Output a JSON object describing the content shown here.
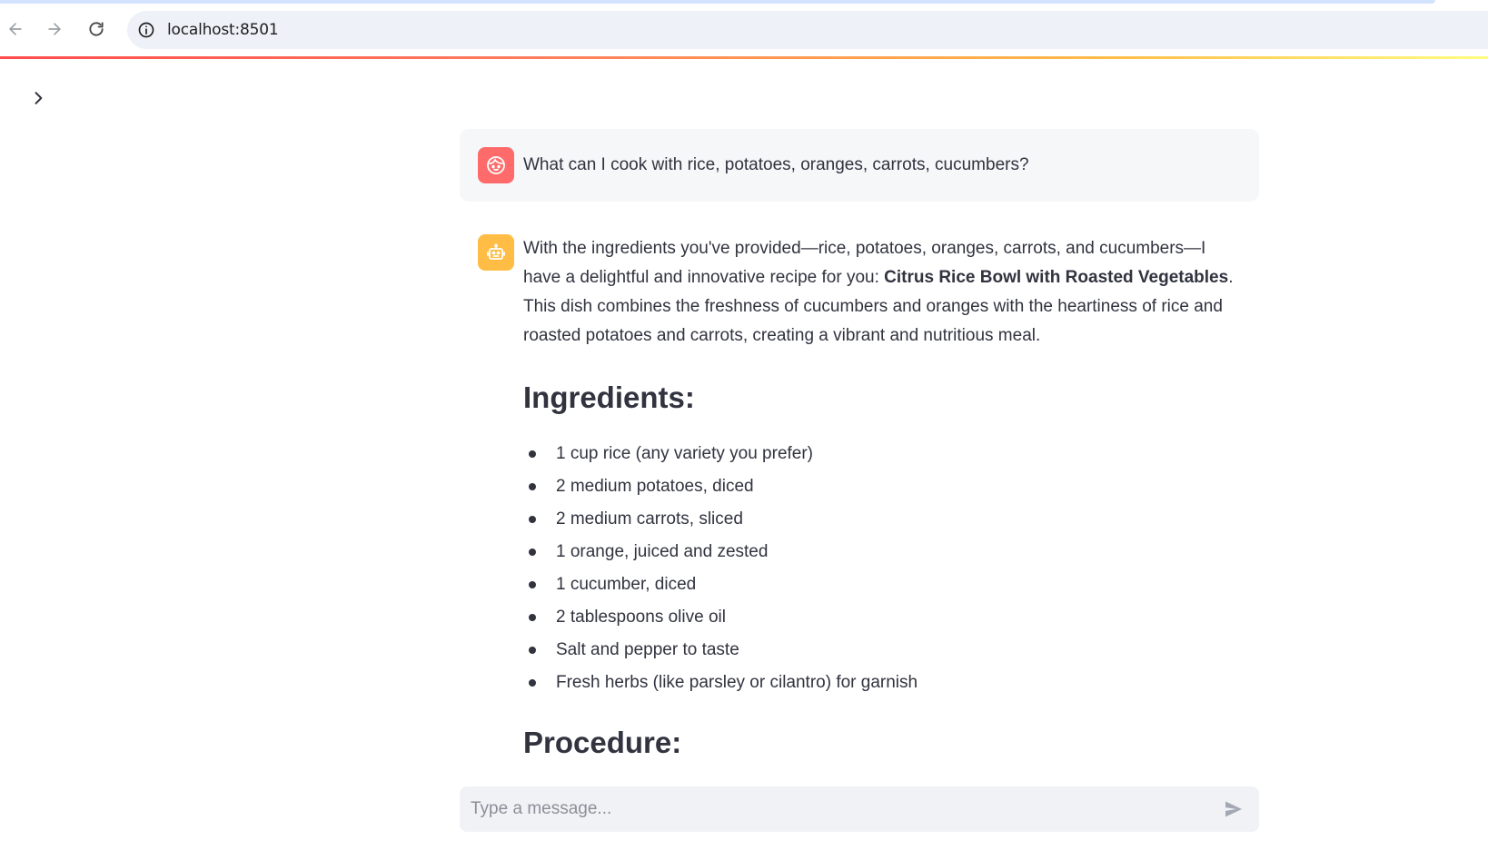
{
  "browser": {
    "url": "localhost:8501"
  },
  "chat": {
    "user_message": "What can I cook with rice, potatoes, oranges, carrots, cucumbers?",
    "assistant": {
      "intro_before": "With the ingredients you've provided—rice, potatoes, oranges, carrots, and cucumbers—I have a delightful and innovative recipe for you: ",
      "recipe_name": "Citrus Rice Bowl with Roasted Vegetables",
      "intro_after": ". This dish combines the freshness of cucumbers and oranges with the heartiness of rice and roasted potatoes and carrots, creating a vibrant and nutritious meal.",
      "ingredients_heading": "Ingredients:",
      "ingredients": [
        "1 cup rice (any variety you prefer)",
        "2 medium potatoes, diced",
        "2 medium carrots, sliced",
        "1 orange, juiced and zested",
        "1 cucumber, diced",
        "2 tablespoons olive oil",
        "Salt and pepper to taste",
        "Fresh herbs (like parsley or cilantro) for garnish"
      ],
      "procedure_heading": "Procedure:"
    }
  },
  "input": {
    "placeholder": "Type a message..."
  },
  "icons": {
    "back": "arrow-left-icon",
    "forward": "arrow-right-icon",
    "reload": "reload-icon",
    "site_info": "info-circle-icon",
    "sidebar": "chevron-right-icon",
    "user_avatar": "user-face-icon",
    "bot_avatar": "robot-icon",
    "send": "send-icon"
  },
  "colors": {
    "user_avatar": "#ff6b6b",
    "bot_avatar": "#ffbd45",
    "accent_gradient_start": "#ff4b4b",
    "accent_gradient_end": "#fffd80"
  }
}
